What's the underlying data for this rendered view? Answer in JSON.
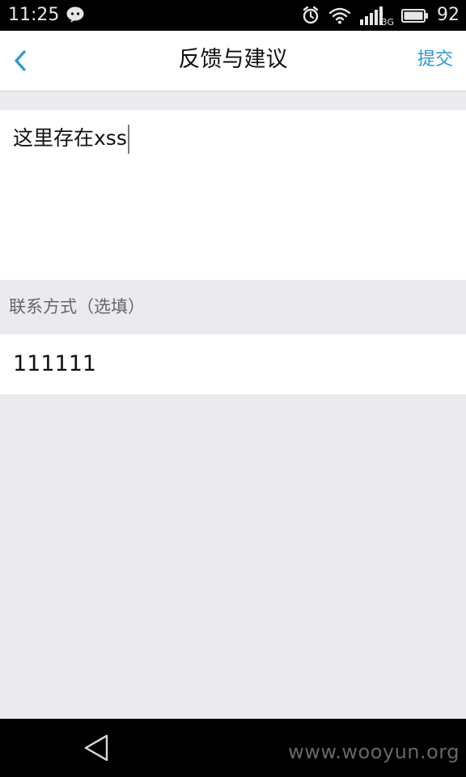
{
  "status_bar": {
    "time": "11:25",
    "battery": "92",
    "network_label": "3G"
  },
  "nav": {
    "title": "反馈与建议",
    "submit": "提交"
  },
  "feedback": {
    "text": "这里存在xss"
  },
  "contact": {
    "label": "联系方式（选填）",
    "value": "111111"
  },
  "watermark": "www.wooyun.org",
  "colors": {
    "accent": "#2f97d6",
    "background": "#ebebef",
    "bar": "#000000"
  }
}
